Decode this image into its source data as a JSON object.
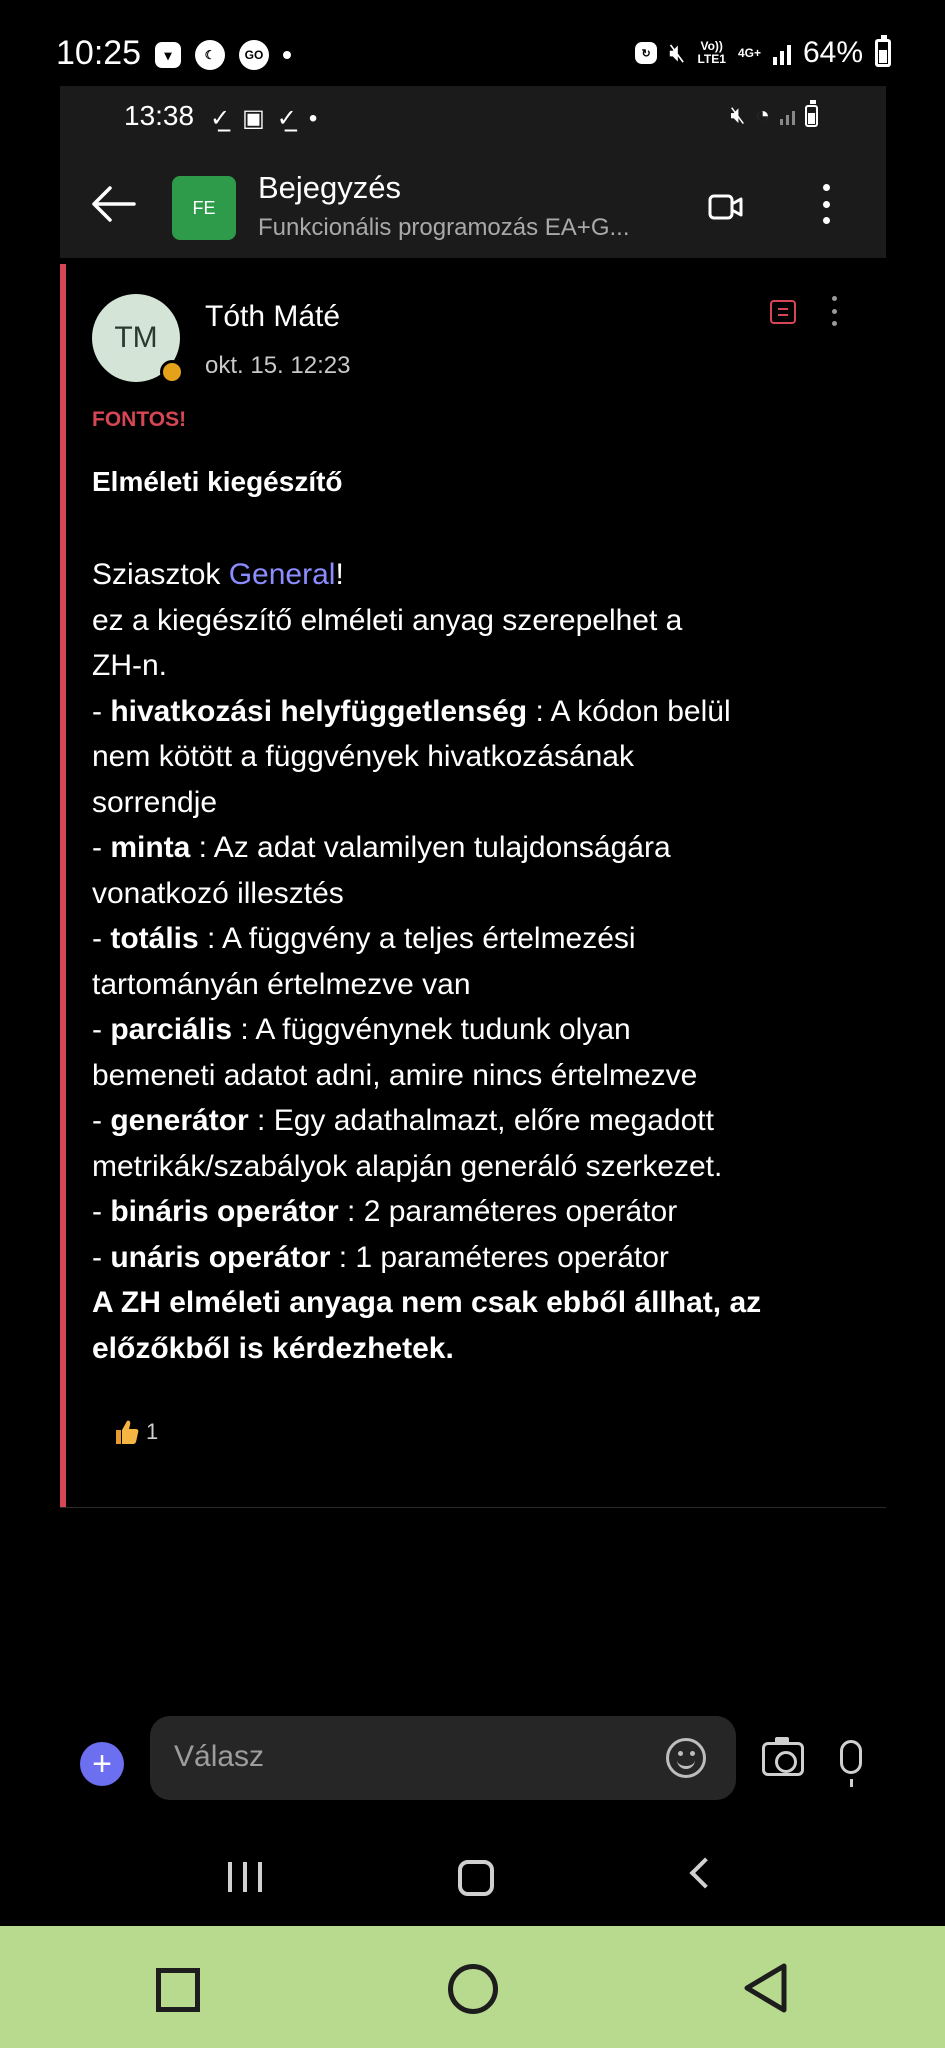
{
  "outer_status": {
    "time": "10:25",
    "notif_go": "GO",
    "volte_label": "Vo))\nLTE1",
    "network": "4G+",
    "battery": "64%"
  },
  "inner_status": {
    "time": "13:38"
  },
  "appbar": {
    "title": "Bejegyzés",
    "subtitle": "Funkcionális programozás EA+G...",
    "team_initials": "FE"
  },
  "post": {
    "author_initials": "TM",
    "author": "Tóth Máté",
    "timestamp": "okt. 15. 12:23",
    "importance": "FONTOS!",
    "title": "Elméleti kiegészítő",
    "greeting": "Sziasztok ",
    "mention": "General",
    "greeting_end": "!",
    "intro_1": "ez a kiegészítő elméleti anyag szerepelhet a",
    "intro_2": "ZH-n.",
    "items": [
      {
        "prefix": "- ",
        "term": "hivatkozási helyfüggetlenség",
        "line1": " : A kódon belül",
        "line2": "nem kötött a függvények hivatkozásának",
        "line3": "sorrendje"
      },
      {
        "prefix": "- ",
        "term": "minta",
        "line1": " : Az adat valamilyen tulajdonságára",
        "line2": "vonatkozó illesztés"
      },
      {
        "prefix": "- ",
        "term": "totális",
        "line1": " : A függvény a teljes értelmezési",
        "line2": "tartományán értelmezve van"
      },
      {
        "prefix": "- ",
        "term": "parciális",
        "line1": " : A függvénynek tudunk olyan",
        "line2": "bemeneti adatot adni, amire nincs értelmezve"
      },
      {
        "prefix": "- ",
        "term": "generátor",
        "line1": " : Egy adathalmazt, előre megadott",
        "line2": "metrikák/szabályok alapján generáló szerkezet."
      },
      {
        "prefix": "- ",
        "term": "bináris operátor",
        "line1": " : 2 paraméteres operátor"
      },
      {
        "prefix": "- ",
        "term": "unáris operátor",
        "line1": " : 1 paraméteres operátor"
      }
    ],
    "closing_1": "A ZH elméleti anyaga nem csak ebből állhat, az",
    "closing_2": "előzőkből is kérdezhetek.",
    "reaction_count": "1"
  },
  "reply": {
    "placeholder": "Válasz"
  },
  "colors": {
    "accent_red": "#d74654",
    "mention": "#8b8cff",
    "team_green": "#2d9b4a",
    "plus_purple": "#6b6ff0",
    "outer_nav_bg": "#b8da8f"
  },
  "icons": [
    "back-arrow-icon",
    "meet-now-icon",
    "more-vertical-icon",
    "flag-icon",
    "thumbs-up-icon",
    "plus-icon",
    "emoji-icon",
    "camera-icon",
    "microphone-icon"
  ]
}
